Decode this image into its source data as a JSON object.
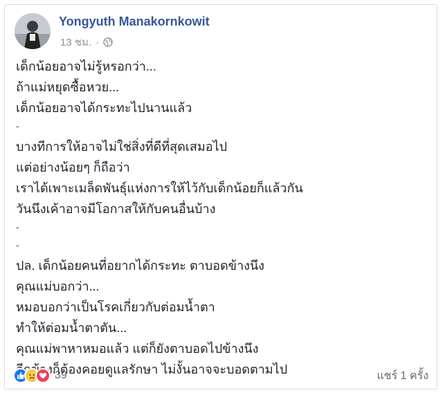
{
  "post": {
    "author": "Yongyuth Manakornkowit",
    "time": "13 ชม.",
    "separator": "·",
    "privacy_icon": "globe-icon",
    "lines": [
      "เด็กน้อยอาจไม่รู้หรอกว่า...",
      "ถ้าแม่หยุดซื้อหวย...",
      "เด็กน้อยอาจได้กระทะไปนานแล้ว",
      "-",
      "บางทีการให้อาจไม่ใช่สิ่งที่ดีที่สุดเสมอไป",
      "แต่อย่างน้อยๆ ก็ถือว่า",
      "เราได้เพาะเมล็ดพันธุ์แห่งการให้ไว้กับเด็กน้อยก็แล้วกัน",
      "วันนึงเค้าอาจมีโอกาสให้กับคนอื่นบ้าง",
      "-",
      "-",
      "ปล. เด็กน้อยคนที่อยากได้กระทะ ตาบอดข้างนึง",
      "คุณแม่บอกว่า...",
      "หมอบอกว่าเป็นโรคเกี่ยวกับต่อมน้ำตา",
      "ทำให้ต่อมน้ำตาตัน...",
      "คุณแม่พาหาหมอแล้ว แต่ก็ยังตาบอดไปข้างนึง",
      "อีกข้างก็ต้องคอยดูแลรักษา ไม่งั้นอาจจะบอดตามไป"
    ]
  },
  "footer": {
    "reactions": [
      "like-icon",
      "sad-icon",
      "love-icon"
    ],
    "reaction_count": "39",
    "shares": "แชร์ 1 ครั้ง"
  },
  "colors": {
    "author": "#365899",
    "like": "#1877f2",
    "sad": "#f7c948",
    "love": "#f33e58"
  }
}
